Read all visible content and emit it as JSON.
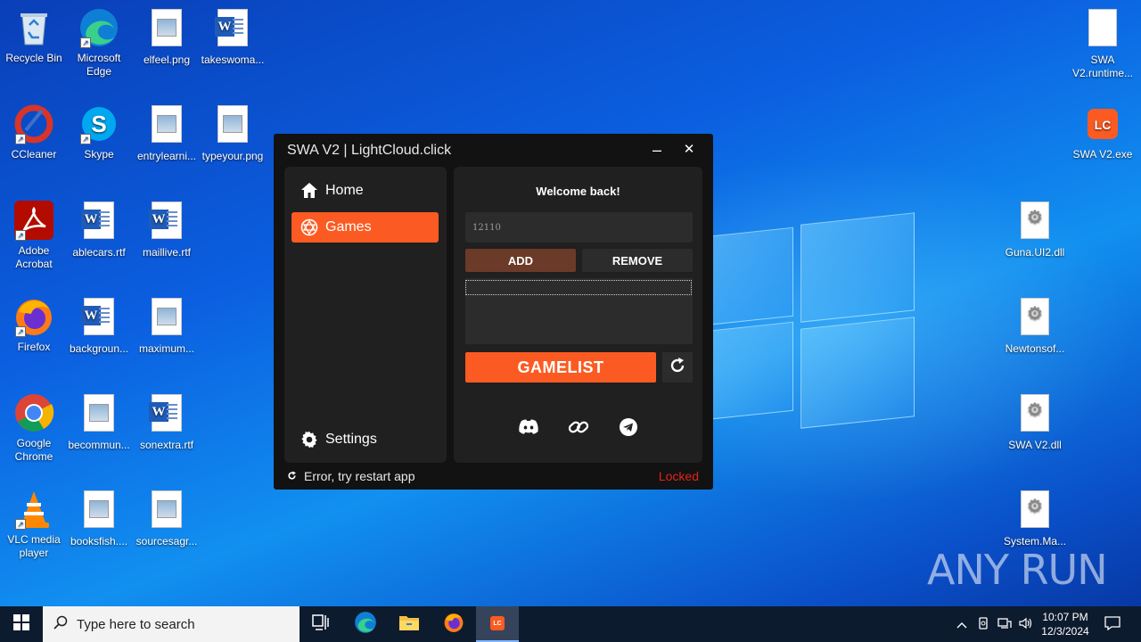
{
  "desktop_icons": {
    "recycle_bin": "Recycle Bin",
    "edge": "Microsoft Edge",
    "elfeel": "elfeel.png",
    "takeswoma": "takeswoma...",
    "ccleaner": "CCleaner",
    "skype": "Skype",
    "entrylearni": "entrylearni...",
    "typeyour": "typeyour.png",
    "acrobat": "Adobe Acrobat",
    "ablecars": "ablecars.rtf",
    "maillive": "maillive.rtf",
    "firefox": "Firefox",
    "backgroun": "backgroun...",
    "maximum": "maximum...",
    "chrome": "Google Chrome",
    "becommun": "becommun...",
    "sonextra": "sonextra.rtf",
    "vlc": "VLC media player",
    "booksfish": "booksfish....",
    "sourcesagr": "sourcesagr...",
    "swa_runtime": "SWA V2.runtime...",
    "swa_exe": "SWA V2.exe",
    "guna": "Guna.UI2.dll",
    "newtonsof": "Newtonsof...",
    "swa_dll": "SWA V2.dll",
    "system_ma": "System.Ma..."
  },
  "app": {
    "title": "SWA V2 | LightCloud.click",
    "minimize": "–",
    "close": "✕",
    "nav": {
      "home": "Home",
      "games": "Games",
      "settings": "Settings"
    },
    "welcome": "Welcome back!",
    "game_id_value": "12110",
    "add_label": "ADD",
    "remove_label": "REMOVE",
    "gamelist_label": "GAMELIST",
    "status_text": "Error, try restart app",
    "lock_status": "Locked",
    "accent_color": "#fb5b22"
  },
  "taskbar": {
    "search_placeholder": "Type here to search",
    "time": "10:07 PM",
    "date": "12/3/2024",
    "app_badge": "LC"
  },
  "watermark": "ANY RUN"
}
